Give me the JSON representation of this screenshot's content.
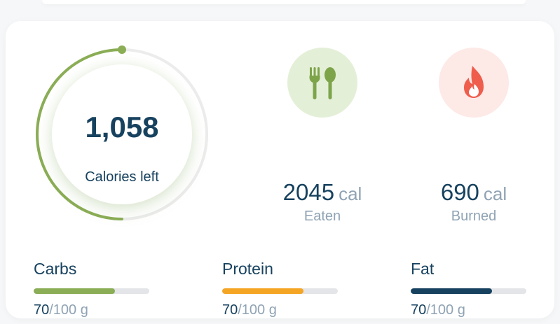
{
  "summary": {
    "calories_left": "1,058",
    "calories_left_label": "Calories left",
    "progress_fraction": 0.5,
    "ring_color": "#8aad55",
    "track_color": "#ececec"
  },
  "stats": {
    "eaten": {
      "value": "2045",
      "unit": "cal",
      "label": "Eaten",
      "icon": "fork-spoon-icon",
      "icon_color": "#7ea44a",
      "bg_color": "#e4efd8"
    },
    "burned": {
      "value": "690",
      "unit": "cal",
      "label": "Burned",
      "icon": "flame-icon",
      "icon_color": "#ef5d4c",
      "bg_color": "#fde9e6"
    }
  },
  "macros": [
    {
      "name": "Carbs",
      "current": "70",
      "total": "/100 g",
      "fraction": 0.7,
      "color": "#8aad55"
    },
    {
      "name": "Protein",
      "current": "70",
      "total": "/100 g",
      "fraction": 0.7,
      "color": "#f5a524"
    },
    {
      "name": "Fat",
      "current": "70",
      "total": "/100 g",
      "fraction": 0.7,
      "color": "#17425f"
    }
  ]
}
